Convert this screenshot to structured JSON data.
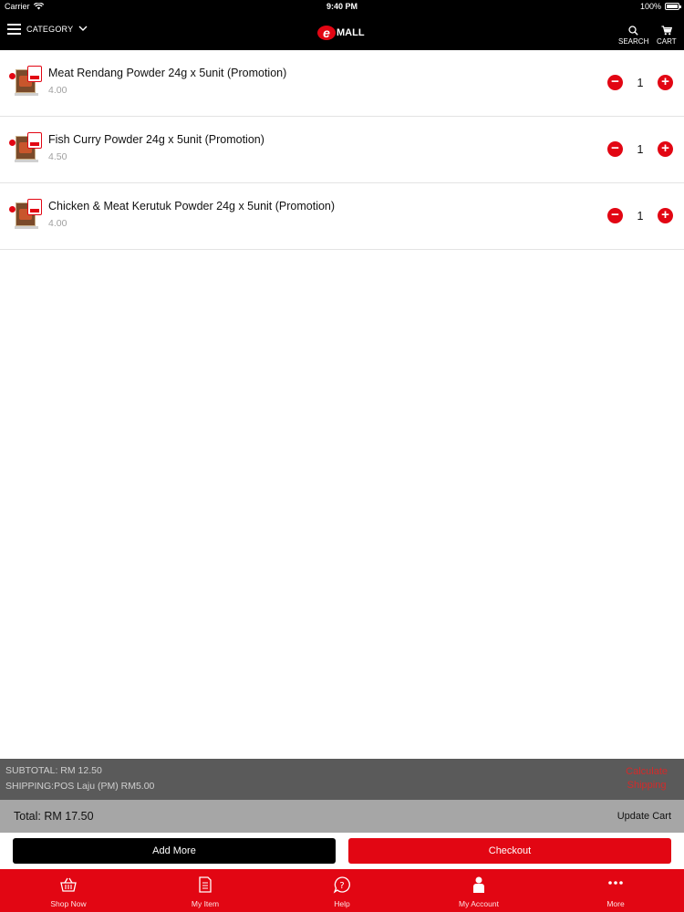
{
  "status_bar": {
    "carrier": "Carrier",
    "time": "9:40 PM",
    "battery": "100%"
  },
  "nav": {
    "category_label": "CATEGORY",
    "logo_text": "MALL",
    "search_label": "SEARCH",
    "cart_label": "CART"
  },
  "cart": {
    "items": [
      {
        "name": "Meat Rendang Powder 24g x 5unit (Promotion)",
        "price": "4.00",
        "qty": "1"
      },
      {
        "name": "Fish Curry Powder 24g x 5unit (Promotion)",
        "price": "4.50",
        "qty": "1"
      },
      {
        "name": "Chicken & Meat Kerutuk Powder 24g x 5unit (Promotion)",
        "price": "4.00",
        "qty": "1"
      }
    ]
  },
  "summary": {
    "subtotal": "SUBTOTAL: RM 12.50",
    "shipping": "SHIPPING:POS Laju (PM) RM5.00",
    "calc_line1": "Calculate",
    "calc_line2": "Shipping",
    "total": "Total: RM 17.50",
    "update_cart": "Update Cart"
  },
  "actions": {
    "add_more": "Add More",
    "checkout": "Checkout"
  },
  "tabs": [
    {
      "label": "Shop Now",
      "icon": "basket-icon"
    },
    {
      "label": "My Item",
      "icon": "document-icon"
    },
    {
      "label": "Help",
      "icon": "help-icon"
    },
    {
      "label": "My Account",
      "icon": "person-icon"
    },
    {
      "label": "More",
      "icon": "more-icon"
    }
  ],
  "colors": {
    "brand_red": "#e20613",
    "nav_black": "#000000",
    "summary_gray": "#5a5a5a",
    "total_gray": "#a6a6a6"
  }
}
